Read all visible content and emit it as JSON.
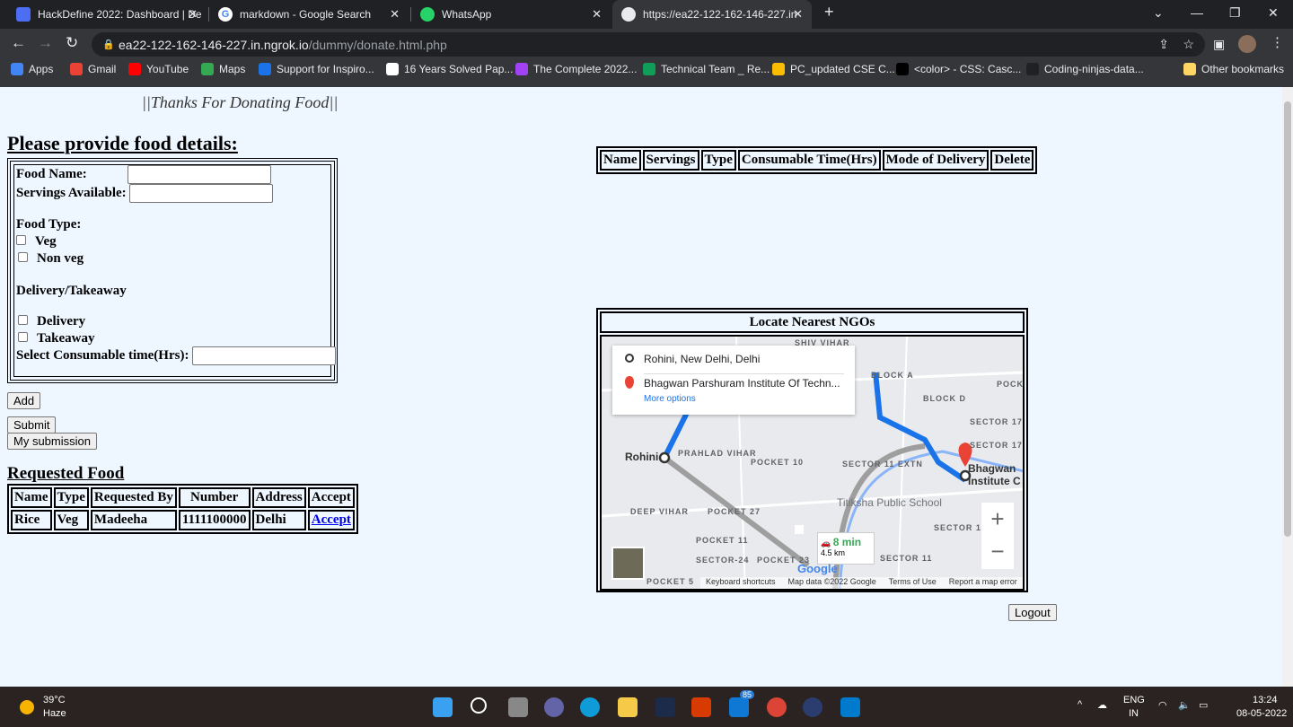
{
  "browser": {
    "tabs": [
      {
        "title": "HackDefine 2022: Dashboard | De",
        "icon": "hackdefine-icon",
        "color": "#4c6ef5"
      },
      {
        "title": "markdown - Google Search",
        "icon": "google-icon",
        "color": "#ffffff"
      },
      {
        "title": "WhatsApp",
        "icon": "whatsapp-icon",
        "color": "#25d366"
      },
      {
        "title": "https://ea22-122-162-146-227.in",
        "icon": "globe-icon",
        "color": "#e8eaed"
      }
    ],
    "url_host": "ea22-122-162-146-227.in.ngrok.io",
    "url_path": "/dummy/donate.html.php",
    "bookmarks": [
      {
        "label": "Apps",
        "color": "#4285f4"
      },
      {
        "label": "Gmail",
        "color": "#ea4335"
      },
      {
        "label": "YouTube",
        "color": "#ff0000"
      },
      {
        "label": "Maps",
        "color": "#34a853"
      },
      {
        "label": "Support for Inspiro...",
        "color": "#1a73e8"
      },
      {
        "label": "16 Years Solved Pap...",
        "color": "#ffffff"
      },
      {
        "label": "The Complete 2022...",
        "color": "#a142f4"
      },
      {
        "label": "Technical Team _ Re...",
        "color": "#0f9d58"
      },
      {
        "label": "PC_updated CSE C...",
        "color": "#fbbc04"
      },
      {
        "label": "<color> - CSS: Casc...",
        "color": "#000000"
      },
      {
        "label": "Coding-ninjas-data...",
        "color": "#202124"
      }
    ],
    "other_bookmarks": "Other bookmarks"
  },
  "page": {
    "banner": "||Thanks For Donating Food||",
    "form_title": "Please provide food details:",
    "form": {
      "food_name_label": "Food Name:",
      "food_name_value": "",
      "servings_label": "Servings Available:",
      "servings_value": "",
      "food_type_label": "Food Type:",
      "veg": "Veg",
      "nonveg": "Non veg",
      "delivery_label": "Delivery/Takeaway",
      "delivery": "Delivery",
      "takeaway": "Takeaway",
      "time_label": "Select Consumable time(Hrs):",
      "time_value": ""
    },
    "buttons": {
      "add": "Add",
      "submit": "Submit",
      "my_submission": "My submission",
      "logout": "Logout"
    },
    "food_table": {
      "headers": [
        "Name",
        "Servings",
        "Type",
        "Consumable Time(Hrs)",
        "Mode of Delivery",
        "Delete"
      ]
    },
    "requested": {
      "title": "Requested Food",
      "headers": [
        "Name",
        "Type",
        "Requested By",
        "Number",
        "Address",
        "Accept"
      ],
      "rows": [
        [
          "Rice",
          "Veg",
          "Madeeha",
          "1111100000",
          "Delhi",
          "Accept"
        ]
      ]
    },
    "map": {
      "title": "Locate Nearest NGOs",
      "origin": "Rohini, New Delhi, Delhi",
      "destination": "Bhagwan Parshuram Institute Of Techn...",
      "more_options": "More options",
      "eta": "8 min",
      "distance": "4.5 km",
      "route_color": "#1a73e8",
      "labels": [
        "SHIV VIHAR",
        "Rohini",
        "PRAHLAD VIHAR",
        "POCKET 10",
        "DEEP VIHAR",
        "POCKET 27",
        "POCKET 11",
        "SECTOR-24",
        "POCKET 23",
        "SECTOR 11 EXTN",
        "Titiksha Public School",
        "BLOCK A",
        "BLOCK D",
        "SECTOR 17",
        "SECTOR 17A",
        "POCKET 9",
        "SECTOR 11D",
        "SECTOR 11",
        "Bhagwan Institute C",
        "POCKET 5"
      ],
      "footer": [
        "Keyboard shortcuts",
        "Map data ©2022 Google",
        "Terms of Use",
        "Report a map error"
      ],
      "google": "Google"
    }
  },
  "taskbar": {
    "temp": "39°C",
    "weather": "Haze",
    "lang1": "ENG",
    "lang2": "IN",
    "time": "13:24",
    "date": "08-05-2022",
    "mail_badge": "85"
  }
}
